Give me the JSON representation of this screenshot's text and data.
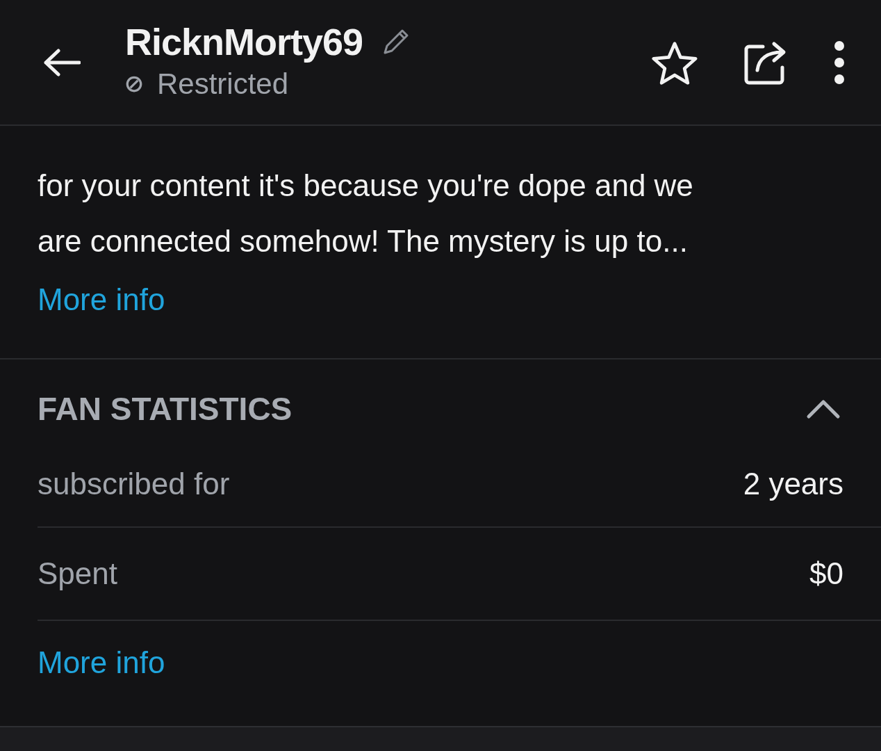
{
  "header": {
    "title": "RicknMorty69",
    "status": "Restricted"
  },
  "bio": {
    "lines": [
      "for your content it's because you're dope and we",
      "are connected somehow! The mystery is up to..."
    ],
    "link": "More info"
  },
  "fan_statistics": {
    "title": "FAN STATISTICS",
    "expanded": true,
    "rows": [
      {
        "label": "subscribed for",
        "value": "2 years"
      },
      {
        "label": "Spent",
        "value": "$0"
      }
    ],
    "link": "More info"
  }
}
